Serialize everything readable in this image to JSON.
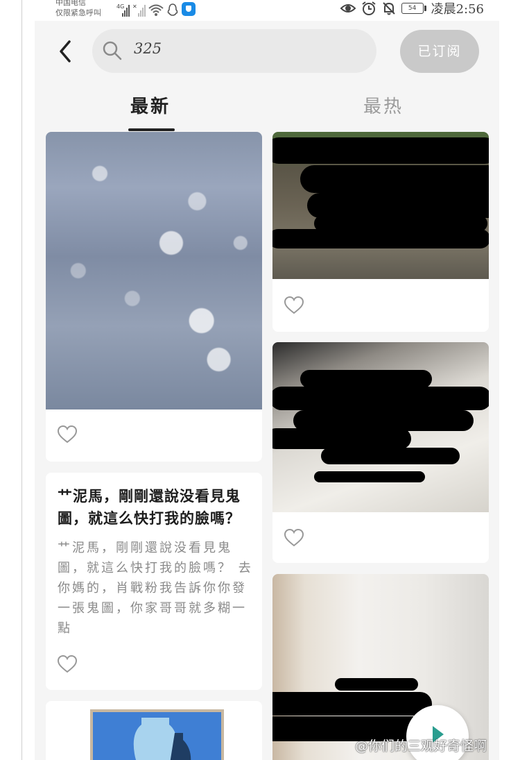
{
  "status_bar": {
    "carrier_line1": "中国电信",
    "carrier_line2": "仅限紧急呼叫",
    "network_tag": "4G",
    "battery": "54",
    "time": "凌晨2:56"
  },
  "header": {
    "search_query": "325",
    "subscribed_label": "已订阅"
  },
  "tabs": [
    {
      "label": "最新",
      "active": true
    },
    {
      "label": "最热",
      "active": false
    }
  ],
  "feed": {
    "left": [
      {
        "type": "image",
        "image": "sparkling-water-photo"
      },
      {
        "type": "text",
        "title": "艹泥馬，剛剛還說没看見鬼圖，就這么快打我的臉嗎？",
        "excerpt": "艹泥馬，剛剛還說没看見鬼圖，就這么快打我的臉嗎？  去你媽的，肖戰粉我告訴你你發一張鬼圖，你家哥哥就多糊一點"
      },
      {
        "type": "image",
        "image": "blue-vase-painting"
      }
    ],
    "right": [
      {
        "type": "image",
        "image": "redacted-ground-photo"
      },
      {
        "type": "image",
        "image": "redacted-bed-photo"
      },
      {
        "type": "image",
        "image": "redacted-room-photo"
      }
    ]
  },
  "watermark": "@你们的三观好奇怪啊",
  "colors": {
    "accent": "#222222",
    "inactive": "#9a9a9a",
    "subscribe_bg": "#c9c9c9"
  }
}
